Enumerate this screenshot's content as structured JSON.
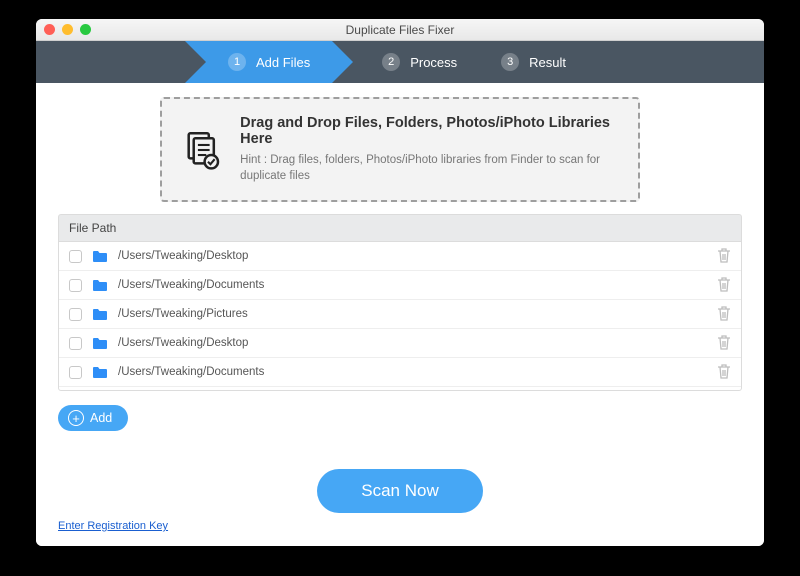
{
  "window": {
    "title": "Duplicate Files Fixer"
  },
  "colors": {
    "accent": "#46a7f5",
    "stepbar": "#4a5662",
    "step_active": "#3d9ae8"
  },
  "steps": [
    {
      "num": "1",
      "label": "Add Files",
      "active": true
    },
    {
      "num": "2",
      "label": "Process",
      "active": false
    },
    {
      "num": "3",
      "label": "Result",
      "active": false
    }
  ],
  "dropzone": {
    "title": "Drag and Drop Files, Folders, Photos/iPhoto Libraries Here",
    "hint": "Hint : Drag files, folders, Photos/iPhoto libraries from Finder to scan for duplicate files"
  },
  "list": {
    "header": "File Path",
    "rows": [
      {
        "path": "/Users/Tweaking/Desktop"
      },
      {
        "path": "/Users/Tweaking/Documents"
      },
      {
        "path": "/Users/Tweaking/Pictures"
      },
      {
        "path": "/Users/Tweaking/Desktop"
      },
      {
        "path": "/Users/Tweaking/Documents"
      }
    ]
  },
  "buttons": {
    "add": "Add",
    "scan": "Scan Now"
  },
  "footer": {
    "registration_link": "Enter Registration Key"
  }
}
